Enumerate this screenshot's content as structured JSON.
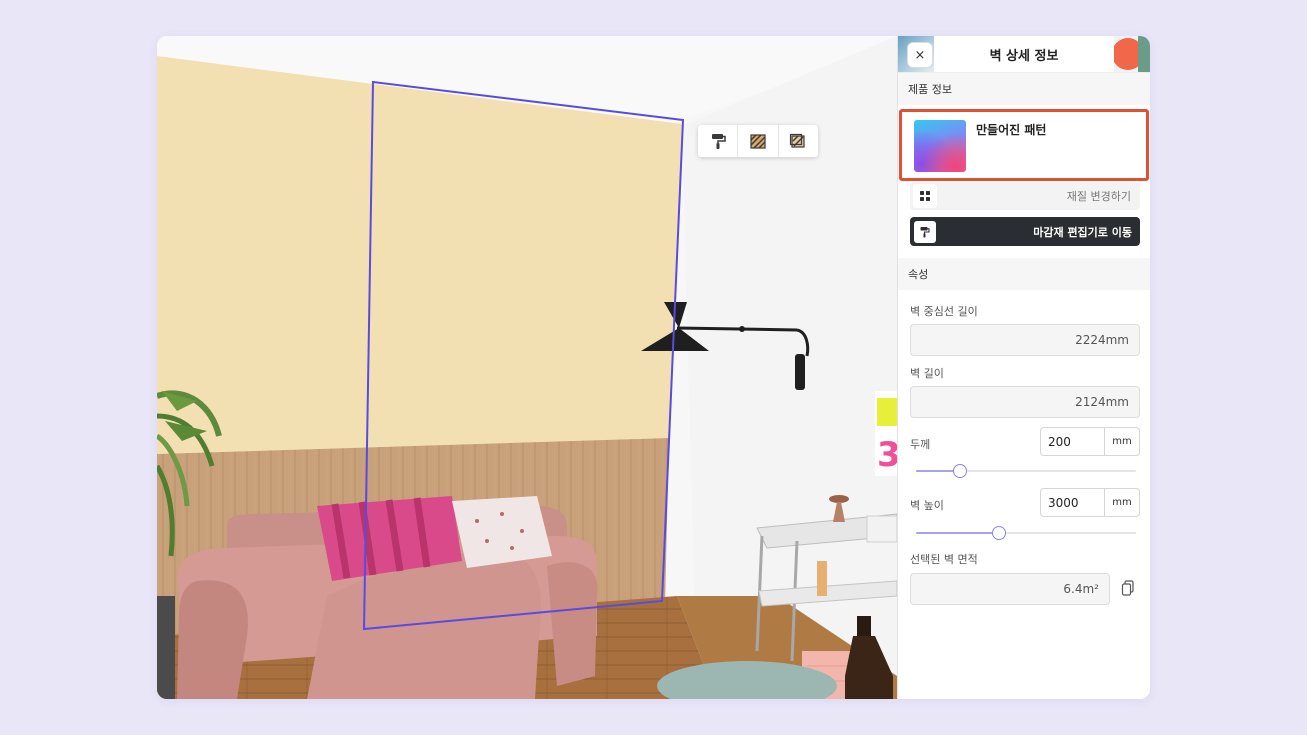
{
  "panel": {
    "title": "벽 상세 정보",
    "close_label": "×",
    "product_section_label": "제품 정보",
    "product_name": "만들어진 패턴",
    "change_material_label": "재질 변경하기",
    "finish_editor_label": "마감재 편집기로 이동",
    "properties_section_label": "속성",
    "center_length_label": "벽 중심선 길이",
    "center_length_value": "2224mm",
    "wall_length_label": "벽 길이",
    "wall_length_value": "2124mm",
    "thickness_label": "두께",
    "thickness_value": "200",
    "thickness_unit": "mm",
    "thickness_slider_fraction": 0.2,
    "height_label": "벽 높이",
    "height_value": "3000",
    "height_unit": "mm",
    "height_slider_fraction": 0.375,
    "area_label": "선택된 벽 면적",
    "area_value": "6.4m²"
  },
  "toolbar": {
    "icons": [
      "paint-roller-icon",
      "wall-texture-icon",
      "wall-pattern-icon"
    ]
  },
  "colors": {
    "selection_outline": "#5a4be0",
    "highlight_border": "#e2512f",
    "primary_button": "#2a2d31",
    "slider_accent": "#8a84ec",
    "page_background": "#e9e6f8"
  }
}
